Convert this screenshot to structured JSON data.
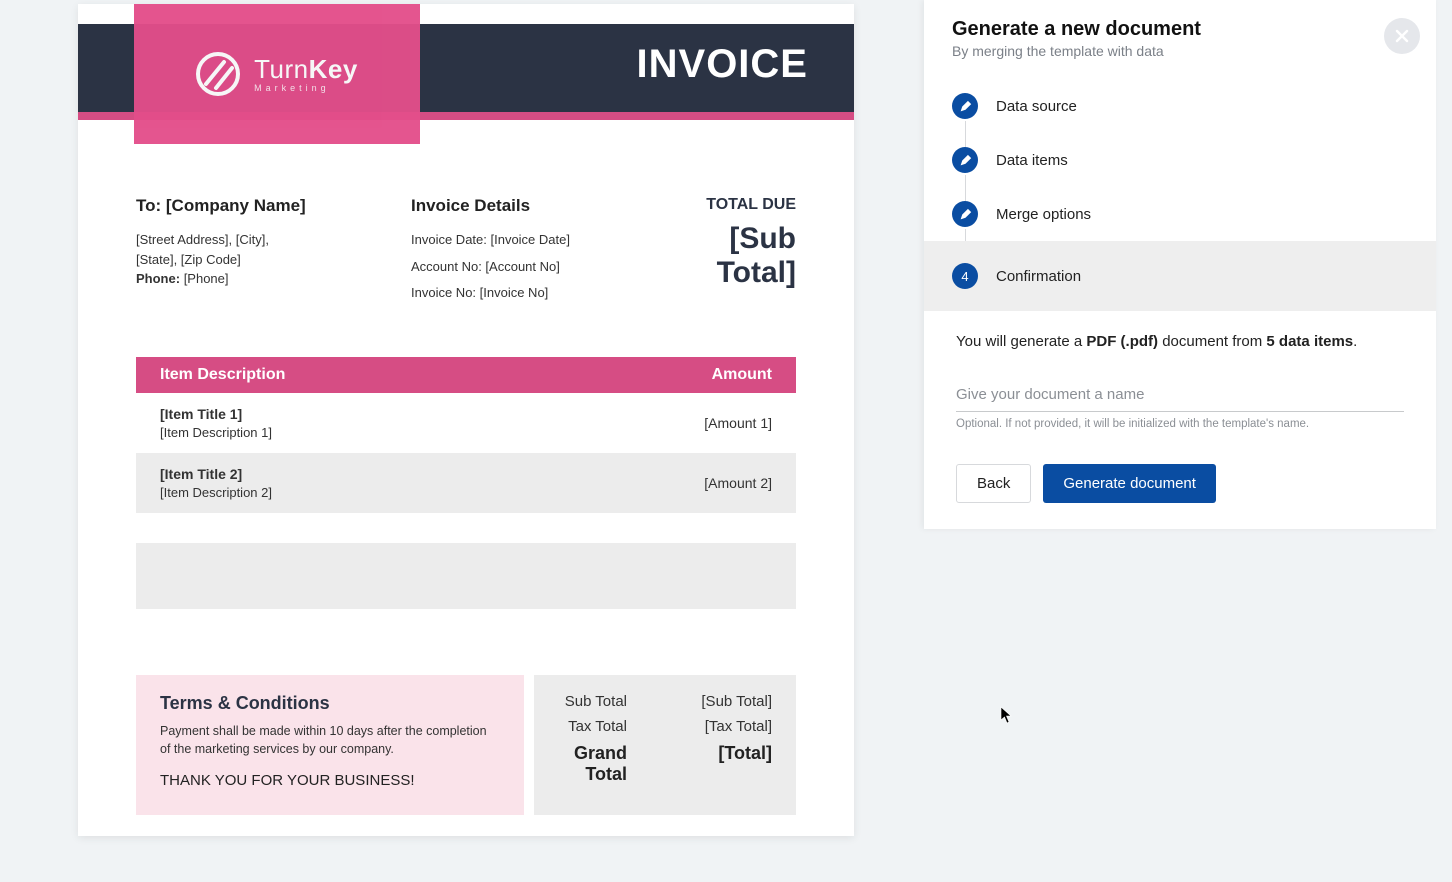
{
  "doc": {
    "brand_a": "Turn",
    "brand_b": "Key",
    "brand_tag": "Marketing",
    "header_title": "INVOICE",
    "to_label": "To: [Company Name]",
    "address_l1": "[Street Address], [City],",
    "address_l2": "[State], [Zip Code]",
    "phone_label": "Phone:",
    "phone_value": "[Phone]",
    "inv_head": "Invoice Details",
    "inv_date": "Invoice Date: [Invoice Date]",
    "inv_acct": "Account No: [Account No]",
    "inv_no": "Invoice No: [Invoice No]",
    "due_label": "TOTAL DUE",
    "due_value": "[Sub Total]",
    "col_desc": "Item Description",
    "col_amt": "Amount",
    "items": [
      {
        "title": "[Item Title 1]",
        "desc": "[Item Description 1]",
        "amount": "[Amount 1]"
      },
      {
        "title": "[Item Title 2]",
        "desc": "[Item Description 2]",
        "amount": "[Amount 2]"
      }
    ],
    "terms_head": "Terms & Conditions",
    "terms_body": "Payment shall be made within 10 days after the completion of the marketing services by our company.",
    "terms_thanks": "THANK YOU FOR YOUR BUSINESS!",
    "sub_lbl": "Sub Total",
    "sub_val": "[Sub Total]",
    "tax_lbl": "Tax Total",
    "tax_val": "[Tax Total]",
    "grand_lbl": "Grand Total",
    "grand_val": "[Total]"
  },
  "panel": {
    "title": "Generate a new document",
    "subtitle": "By merging the template with data",
    "steps": {
      "s1": "Data source",
      "s2": "Data items",
      "s3": "Merge options",
      "s4_num": "4",
      "s4": "Confirmation"
    },
    "conf_pre": "You will generate a ",
    "conf_fmt": "PDF (.pdf)",
    "conf_mid": " document from ",
    "conf_cnt": "5 data items",
    "conf_end": ".",
    "input_placeholder": "Give your document a name",
    "input_help": "Optional. If not provided, it will be initialized with the template's name.",
    "btn_back": "Back",
    "btn_generate": "Generate document"
  }
}
